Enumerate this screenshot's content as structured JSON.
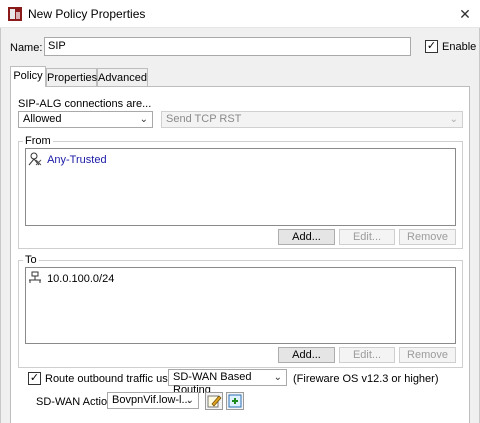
{
  "window": {
    "title": "New Policy Properties",
    "close_symbol": "✕",
    "icon": "watchguard-policy-icon"
  },
  "name_row": {
    "label": "Name:",
    "value": "SIP",
    "enable_label": "Enable",
    "enable_checked": true
  },
  "tabs": [
    {
      "label": "Policy",
      "active": true
    },
    {
      "label": "Properties",
      "active": false
    },
    {
      "label": "Advanced",
      "active": false
    }
  ],
  "policy": {
    "connections_label": "SIP-ALG connections are...",
    "action_value": "Allowed",
    "tcp_value": "Send TCP RST",
    "from": {
      "title": "From",
      "items": [
        {
          "icon": "any-trusted-icon",
          "label": "Any-Trusted"
        }
      ],
      "add_label": "Add...",
      "edit_label": "Edit...",
      "remove_label": "Remove"
    },
    "to": {
      "title": "To",
      "items": [
        {
          "icon": "network-icon",
          "label": "10.0.100.0/24"
        }
      ],
      "add_label": "Add...",
      "edit_label": "Edit...",
      "remove_label": "Remove"
    },
    "route": {
      "checked": true,
      "label": "Route outbound traffic using",
      "value": "SD-WAN Based Routing",
      "note": "(Fireware OS v12.3 or higher)"
    },
    "sdwan": {
      "label": "SD-WAN Action",
      "value": "BovpnVif.low-l..."
    }
  },
  "colors": {
    "link_blue": "#1a1aa6",
    "panel_bg": "#f0f0f0"
  }
}
